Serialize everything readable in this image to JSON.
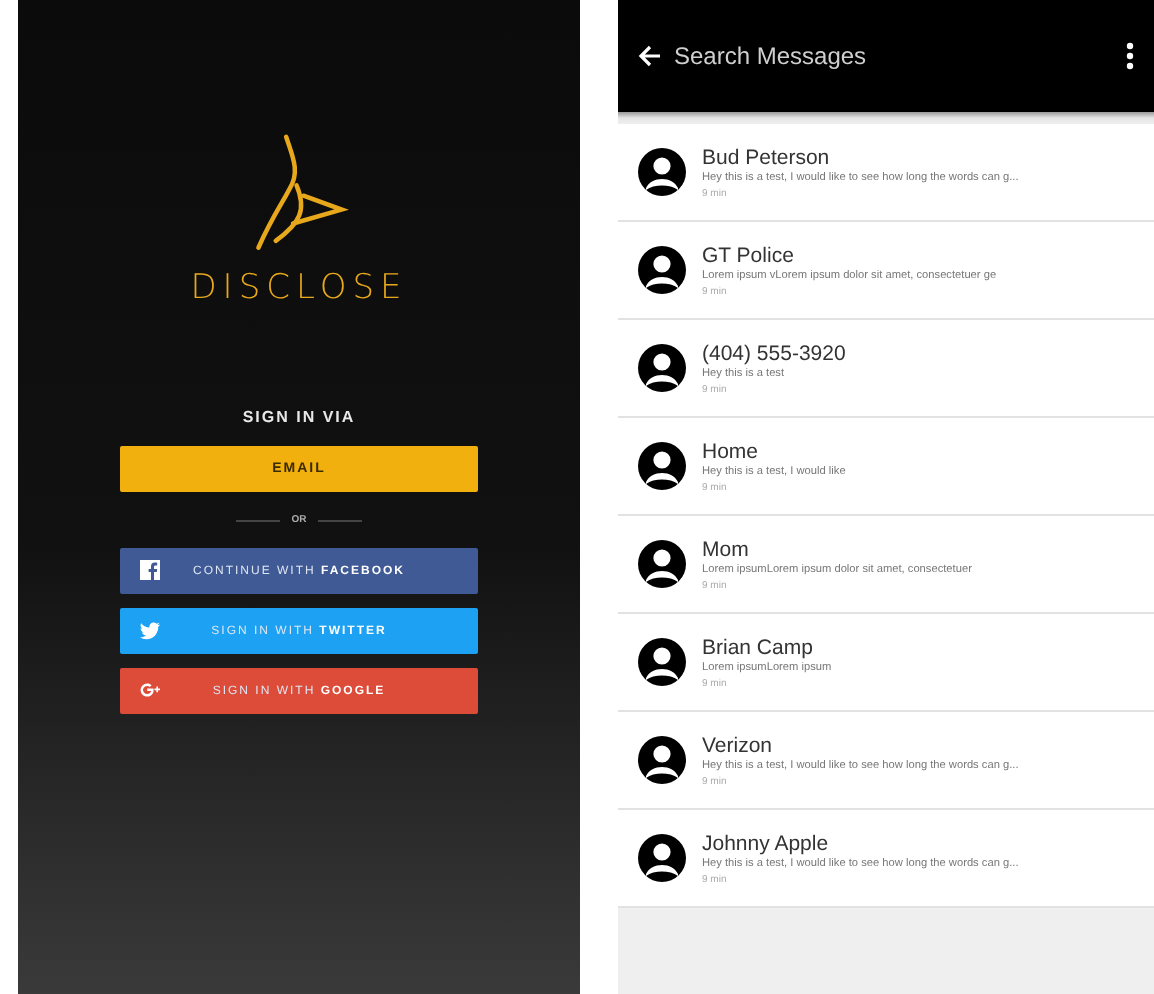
{
  "login": {
    "brand": "DISCLOSE",
    "heading": "SIGN IN VIA",
    "divider": "OR",
    "buttons": [
      {
        "kind": "email",
        "label": "EMAIL"
      },
      {
        "kind": "facebook",
        "label": "CONTINUE WITH **FACEBOOK**"
      },
      {
        "kind": "twitter",
        "label": "SIGN IN WITH **TWITTER**"
      },
      {
        "kind": "google",
        "label": "SIGN IN WITH **GOOGLE**"
      }
    ]
  },
  "messages": {
    "search": {
      "placeholder": "Search Messages"
    },
    "items": [
      {
        "name": "Bud Peterson",
        "preview": "Hey this is a test, I would like to see how long the words can g...",
        "time": "9 min"
      },
      {
        "name": "GT Police",
        "preview": "Lorem ipsum vLorem ipsum dolor sit amet, consectetuer ge",
        "time": "9 min"
      },
      {
        "name": "(404) 555-3920",
        "preview": "Hey this is a test",
        "time": "9 min"
      },
      {
        "name": "Home",
        "preview": "Hey this is a test, I would like",
        "time": "9 min"
      },
      {
        "name": "Mom",
        "preview": "Lorem ipsumLorem ipsum dolor sit amet, consectetuer",
        "time": "9 min"
      },
      {
        "name": "Brian Camp",
        "preview": "Lorem ipsumLorem ipsum",
        "time": "9 min"
      },
      {
        "name": "Verizon",
        "preview": "Hey this is a test, I would like to see how long the words can g...",
        "time": "9 min"
      },
      {
        "name": "Johnny Apple",
        "preview": "Hey this is a test, I would like to see how long the words can g...",
        "time": "9 min"
      }
    ]
  }
}
